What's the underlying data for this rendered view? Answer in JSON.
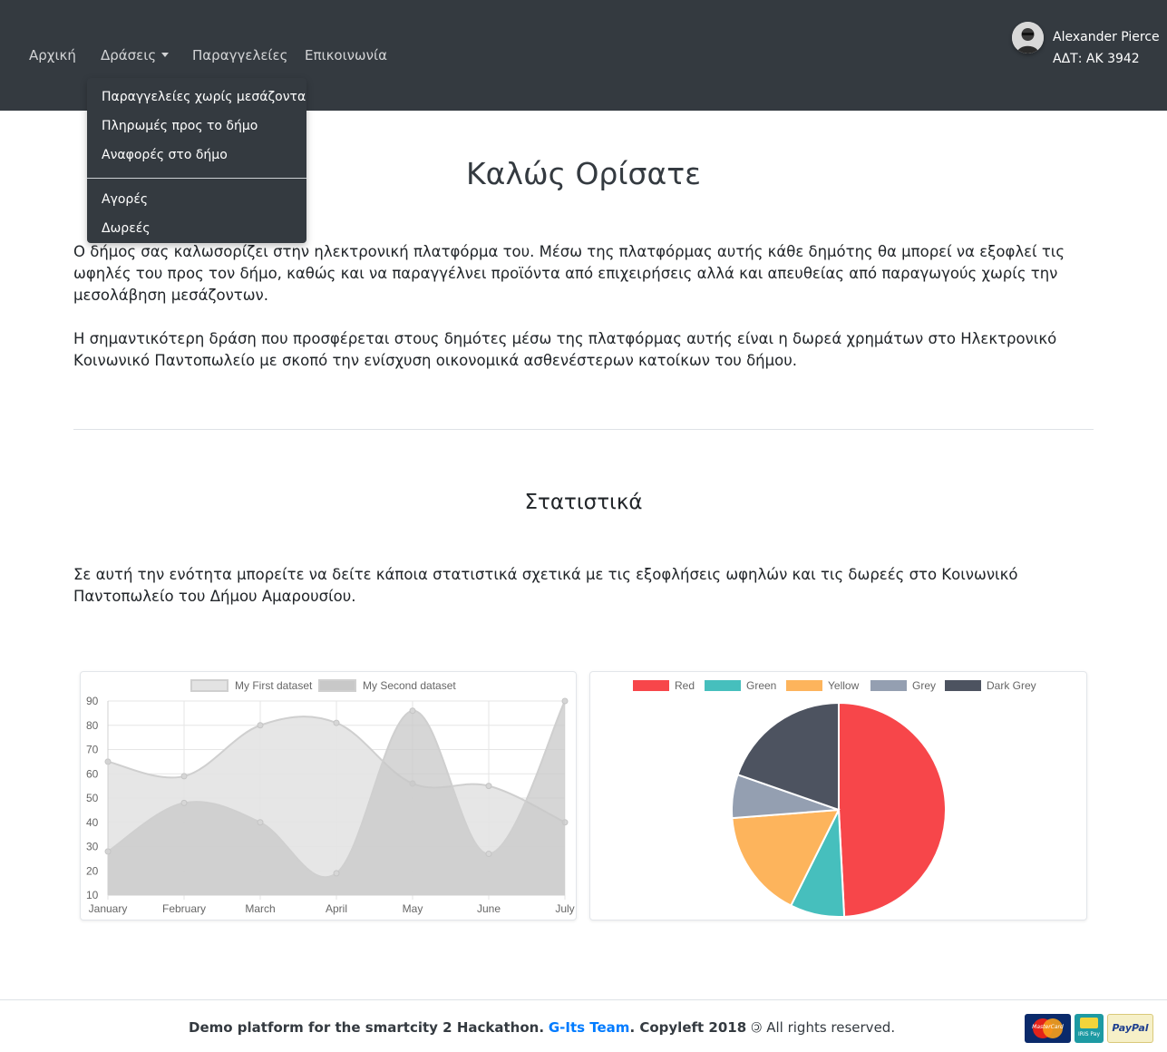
{
  "nav": {
    "home": "Αρχική",
    "actions": "Δράσεις",
    "orders": "Παραγγελείες",
    "contact": "Επικοινωνία"
  },
  "user": {
    "name": "Alexander Pierce",
    "id": "ΑΔΤ: ΑΚ 3942"
  },
  "dropdown": {
    "items": [
      "Παραγγελείες χωρίς μεσάζοντα",
      "Πληρωμές προς το δήμο",
      "Αναφορές στο δήμο",
      "Αγορές",
      "Δωρεές"
    ]
  },
  "main": {
    "title": "Καλώς Ορίσατε",
    "intro": "Ο δήμος σας καλωσορίζει στην ηλεκτρονική πλατφόρμα του. Μέσω της πλατφόρμας αυτής κάθε δημότης θα μπορεί να εξοφλεί τις ωφηλές του προς τον δήμο, καθώς και να παραγγέλνει προϊόντα από επιχειρήσεις αλλά και απευθείας από παραγωγούς χωρίς την μεσολάβηση μεσάζοντων.",
    "donation": "Η σημαντικότερη δράση που προσφέρεται στους δημότες μέσω της πλατφόρμας αυτής είναι η δωρεά χρημάτων στο Ηλεκτρονικό Κοινωνικό Παντοπωλείο με σκοπό την ενίσχυση οικονομικά ασθενέστερων κατοίκων του δήμου.",
    "stats_title": "Στατιστικά",
    "stats_text": "Σε αυτή την ενότητα μπορείτε να δείτε κάποια στατιστικά σχετικά με τις εξοφλήσεις ωφηλών και τις δωρεές στο Κοινωνικό Παντοπωλείο του Δήμου Αμαρουσίου."
  },
  "chart_data": [
    {
      "type": "area",
      "categories": [
        "January",
        "February",
        "March",
        "April",
        "May",
        "June",
        "July"
      ],
      "series": [
        {
          "name": "My First dataset",
          "values": [
            65,
            59,
            80,
            81,
            56,
            55,
            40
          ]
        },
        {
          "name": "My Second dataset",
          "values": [
            28,
            48,
            40,
            19,
            86,
            27,
            90
          ]
        }
      ],
      "ylim": [
        10,
        90
      ],
      "yticks": [
        10,
        20,
        30,
        40,
        50,
        60,
        70,
        80,
        90
      ],
      "grid": true,
      "legend": "top",
      "colors": {
        "first_fill": "#e3e3e3",
        "second_fill": "#c8c8c8",
        "stroke": "#cfcfcf",
        "grid": "#e6e6e6"
      }
    },
    {
      "type": "pie",
      "categories": [
        "Red",
        "Green",
        "Yellow",
        "Grey",
        "Dark Grey"
      ],
      "values": [
        300,
        50,
        100,
        40,
        120
      ],
      "legend": "top",
      "colors": [
        "#f7464a",
        "#46bfbd",
        "#fdb45c",
        "#949fb1",
        "#4d5360"
      ]
    }
  ],
  "footer": {
    "part1": "Demo platform for the smartcity 2 Hackathon.",
    "team": "G-Its Team",
    "part2": ". Copyleft 2018",
    "copyleft_symbol": "🄯",
    "part3": "All rights reserved.",
    "payments": [
      "MasterCard",
      "IRIS Pay",
      "PayPal"
    ]
  }
}
